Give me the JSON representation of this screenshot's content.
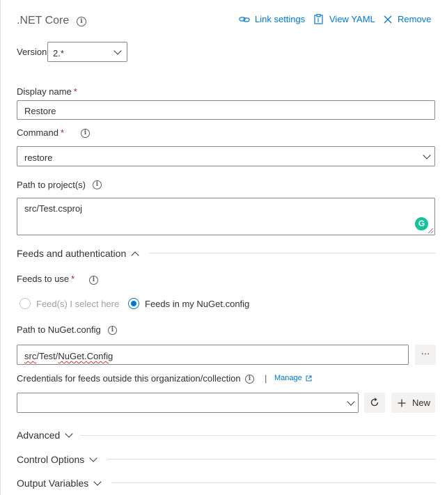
{
  "header": {
    "title": ".NET Core",
    "link_settings": "Link settings",
    "view_yaml": "View YAML",
    "remove": "Remove"
  },
  "version": {
    "label": "Version",
    "value": "2.*"
  },
  "display_name": {
    "label": "Display name",
    "required": "*",
    "value": "Restore"
  },
  "command": {
    "label": "Command",
    "required": "*",
    "value": "restore"
  },
  "path_to_projects": {
    "label": "Path to project(s)",
    "value": "src/Test.csproj"
  },
  "feeds_section": {
    "title": "Feeds and authentication"
  },
  "feeds_to_use": {
    "label": "Feeds to use",
    "required": "*",
    "options": [
      "Feed(s) I select here",
      "Feeds in my NuGet.config"
    ],
    "selected": "Feeds in my NuGet.config"
  },
  "nuget_config": {
    "label": "Path to NuGet.config",
    "value_parts": [
      "src",
      "/Test/",
      "NuGet.Config"
    ],
    "browse": "···"
  },
  "credentials": {
    "label": "Credentials for feeds outside this organization/collection",
    "separator": "|",
    "manage": "Manage",
    "value": "",
    "new_label": "New"
  },
  "sections": {
    "advanced": "Advanced",
    "control_options": "Control Options",
    "output_variables": "Output Variables"
  },
  "colors": {
    "accent": "#0078d4",
    "required": "#a4262c",
    "grammarly": "#15c39a"
  }
}
